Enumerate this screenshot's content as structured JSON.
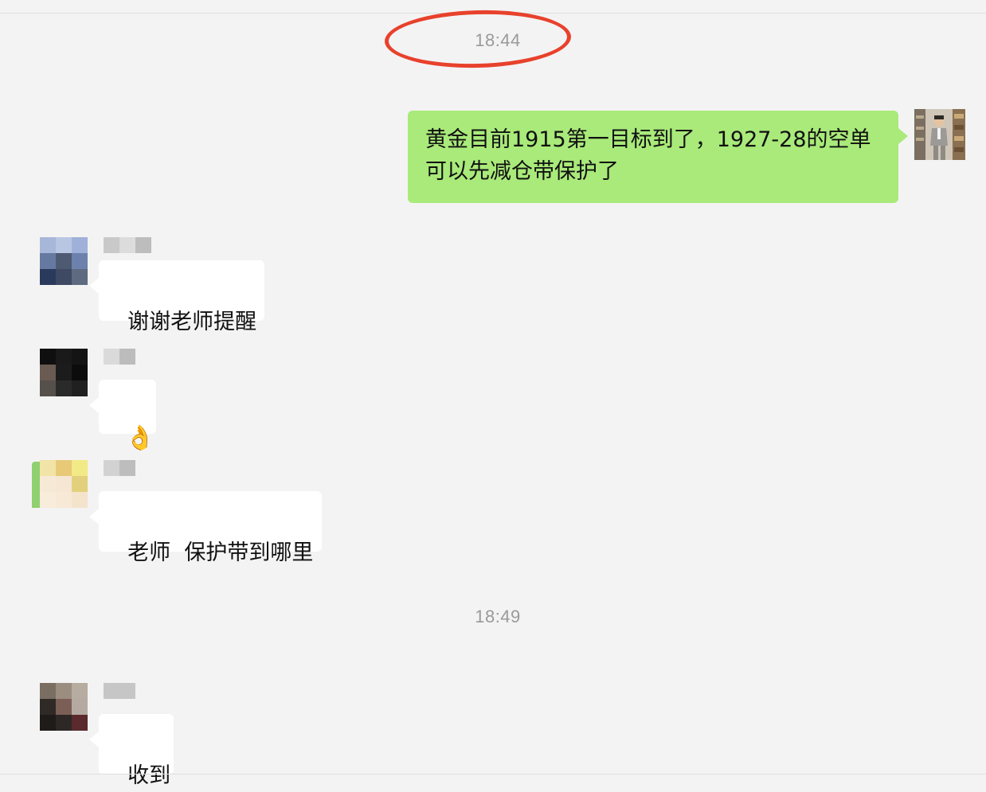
{
  "timestamps": {
    "first": "18:44",
    "second": "18:49"
  },
  "outgoing": {
    "line1": "黄金目前1915第一目标到了，1927-28的空单",
    "line2": "可以先减仓带保护了"
  },
  "messages": [
    {
      "text": "谢谢老师提醒"
    },
    {
      "text": "👌"
    },
    {
      "text": "老师  保护带到哪里"
    },
    {
      "text": "收到"
    }
  ],
  "colors": {
    "background": "#f3f3f3",
    "outgoing_bubble": "#a9ea7a",
    "incoming_bubble": "#ffffff",
    "highlight": "#e8412c",
    "timestamp": "#9a9a9a"
  },
  "icons": {
    "sender_avatar": "user-photo-avatar",
    "incoming_avatars": "pixelated-avatar"
  }
}
